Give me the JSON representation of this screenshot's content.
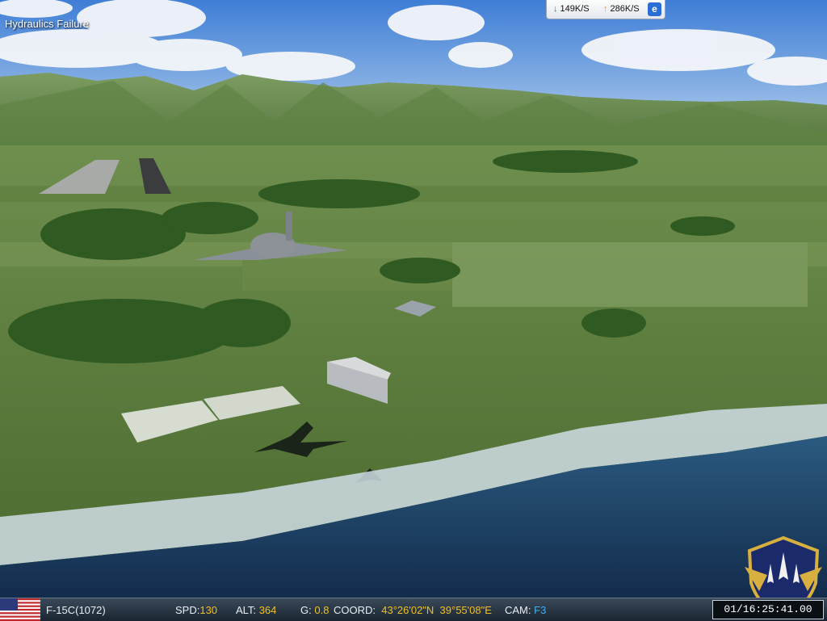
{
  "message": "Hydraulics Failure",
  "net_meter": {
    "download": "149K/S",
    "upload": "286K/S",
    "download_arrow": "↓",
    "upload_arrow": "↑",
    "browser_icon": "e"
  },
  "hud": {
    "aircraft": "F-15C(1072)",
    "spd_label": "SPD:",
    "spd": "130",
    "alt_label": "ALT:",
    "alt": "364",
    "g_label": "G:",
    "g": "0.8",
    "coord_label": "COORD:",
    "lat": "43°26'02\"N",
    "lon": "39°55'08\"E",
    "cam_label": "CAM:",
    "cam": "F3",
    "clock": "01/16:25:41.00"
  },
  "colors": {
    "hud_value": "#f0c020",
    "cam_value": "#40b0f0",
    "sky": "#5a8ed8",
    "sea": "#1e3e62"
  },
  "icons": [
    "download-arrow-icon",
    "upload-arrow-icon",
    "browser-icon",
    "us-flag-icon",
    "squadron-emblem"
  ]
}
